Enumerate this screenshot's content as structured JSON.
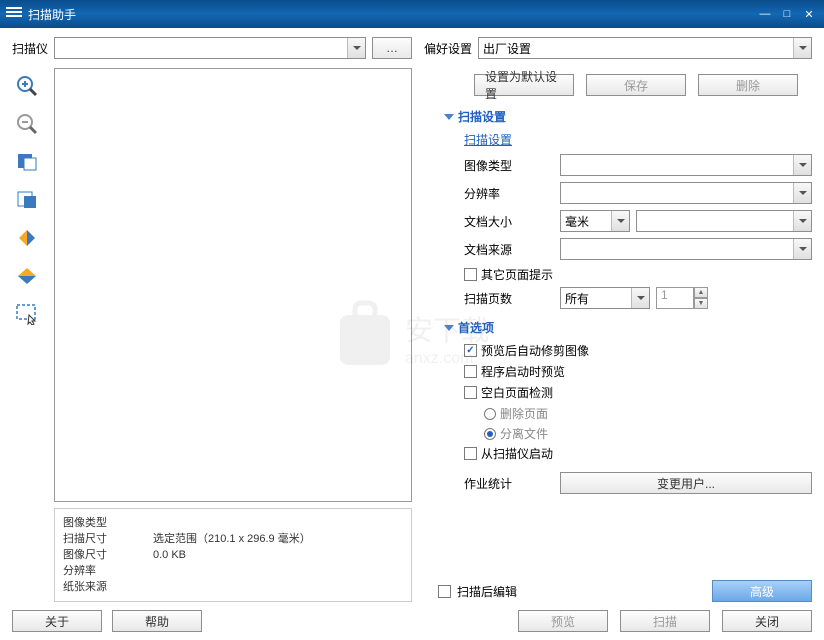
{
  "title": "扫描助手",
  "scanner": {
    "label": "扫描仪",
    "value": "",
    "browse_btn": "…"
  },
  "presets": {
    "label": "偏好设置",
    "value": "出厂设置",
    "set_default": "设置为默认设置",
    "save": "保存",
    "delete": "删除"
  },
  "scan_settings": {
    "header": "扫描设置",
    "subheader": "扫描设置",
    "image_type": {
      "label": "图像类型",
      "value": ""
    },
    "resolution": {
      "label": "分辨率",
      "value": ""
    },
    "doc_size": {
      "label": "文档大小",
      "value": "",
      "unit": "毫米"
    },
    "doc_source": {
      "label": "文档来源",
      "value": ""
    },
    "other_pages": {
      "label": "其它页面提示",
      "checked": false
    },
    "scan_pages": {
      "label": "扫描页数",
      "value": "所有",
      "count": "1"
    }
  },
  "options": {
    "header": "首选项",
    "auto_crop": {
      "label": "预览后自动修剪图像",
      "checked": true
    },
    "preview_on_launch": {
      "label": "程序启动时预览",
      "checked": false
    },
    "blank_detect": {
      "label": "空白页面检测",
      "checked": false
    },
    "delete_page": {
      "label": "删除页面",
      "checked": false
    },
    "separate_file": {
      "label": "分离文件",
      "checked": true
    },
    "launch_from_scanner": {
      "label": "从扫描仪启动",
      "checked": false
    },
    "job_stats": {
      "label": "作业统计",
      "button": "变更用户..."
    }
  },
  "edit_after_scan": {
    "label": "扫描后编辑",
    "checked": false
  },
  "advanced_btn": "高级",
  "info": {
    "image_type": "图像类型",
    "scan_size": "扫描尺寸",
    "image_size": "图像尺寸",
    "resolution": "分辨率",
    "paper_source": "纸张来源",
    "range_val": "选定范围（210.1 x 296.9 毫米）",
    "size_val": "0.0 KB"
  },
  "buttons": {
    "about": "关于",
    "help": "帮助",
    "preview": "预览",
    "scan": "扫描",
    "close": "关闭"
  }
}
